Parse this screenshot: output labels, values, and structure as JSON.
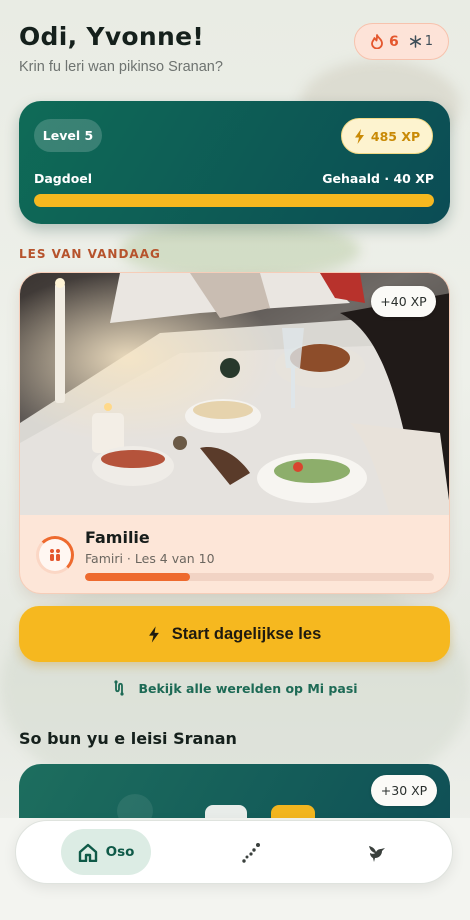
{
  "header": {
    "greeting": "Odi, Yvonne!",
    "subtitle": "Krin fu leri wan pikinso Sranan?"
  },
  "streak": {
    "fire_count": "6",
    "freeze_count": "1",
    "fire_icon": "fire-icon",
    "freeze_icon": "snowflake-icon"
  },
  "level_card": {
    "level_label": "Level 5",
    "xp_label": "485 XP",
    "goal_label": "Dagdoel",
    "goal_status": "Gehaald · 40 XP",
    "goal_progress": 1.0,
    "accent": "#f6b81f"
  },
  "today": {
    "section_label": "LES VAN VANDAAG",
    "xp_badge": "+40 XP",
    "title": "Familie",
    "meta": "Famiri · Les 4 van 10",
    "progress": 0.3,
    "icon": "family-icon",
    "accent": "#ee6a2e"
  },
  "start_button": {
    "label": "Start dagelijkse les",
    "icon": "lightning-icon"
  },
  "worlds_link": {
    "label": "Bekijk alle werelden op Mi pasi",
    "icon": "path-icon"
  },
  "why_section": {
    "title": "So bun yu e leisi Sranan",
    "xp_badge": "+30 XP"
  },
  "tabbar": {
    "home_label": "Oso",
    "tabs": [
      "home-icon",
      "path-dots-icon",
      "bird-icon"
    ]
  }
}
